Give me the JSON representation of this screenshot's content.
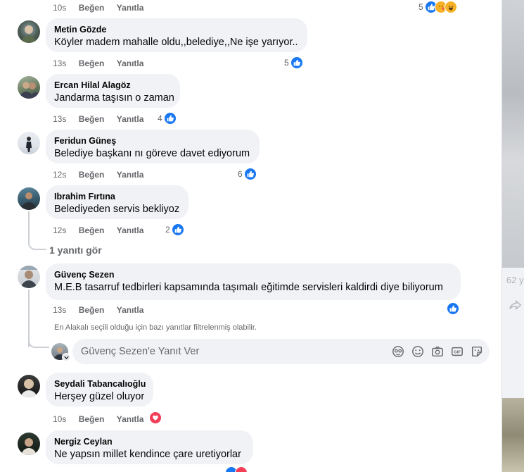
{
  "comments": [
    {
      "name": "Metin Gözde",
      "text": "Köyler madem mahalle oldu,,belediye,,Ne işe yarıyor..",
      "time": "13s",
      "like_label": "Beğen",
      "reply_label": "Yanıtla",
      "reaction_count": "5"
    },
    {
      "name": "Ercan Hilal Alagöz",
      "text": "Jandarma taşısın o zaman",
      "time": "13s",
      "like_label": "Beğen",
      "reply_label": "Yanıtla",
      "reaction_count": "4"
    },
    {
      "name": "Feridun Güneş",
      "text": "Belediye başkanı nı göreve davet ediyorum",
      "time": "12s",
      "like_label": "Beğen",
      "reply_label": "Yanıtla",
      "reaction_count": "6"
    },
    {
      "name": "Ibrahim Fırtına",
      "text": "Belediyeden servis bekliyoz",
      "time": "12s",
      "like_label": "Beğen",
      "reply_label": "Yanıtla",
      "reaction_count": "2"
    },
    {
      "name": "Güvenç Sezen",
      "text": "M.E.B tasarruf tedbirleri kapsamında taşımalı eğitimde servisleri kaldirdi diye biliyorum",
      "time": "13s",
      "like_label": "Beğen",
      "reply_label": "Yanıtla"
    },
    {
      "name": "Seydali Tabancalıoğlu",
      "text": "Herşey güzel oluyor",
      "time": "10s",
      "like_label": "Beğen",
      "reply_label": "Yanıtla"
    },
    {
      "name": "Nergiz Ceylan",
      "text": "Ne yapsın millet kendince çare uretiyorlar"
    }
  ],
  "top_row": {
    "time": "10s",
    "like_label": "Beğen",
    "reply_label": "Yanıtla",
    "reaction_count": "5"
  },
  "view_replies": "1 yanıtı gör",
  "filter_note": "En Alakalı seçili olduğu için bazı yanıtlar filtrelenmiş olabilir.",
  "reply_box": {
    "placeholder": "Güvenç Sezen'e Yanıt Ver"
  },
  "right_panel": {
    "count": "62 y"
  },
  "colors": {
    "like": "#1877f2",
    "heart": "#f33e58",
    "haha": "#f7b125",
    "bubble": "#f0f2f5",
    "muted": "#65676b"
  }
}
